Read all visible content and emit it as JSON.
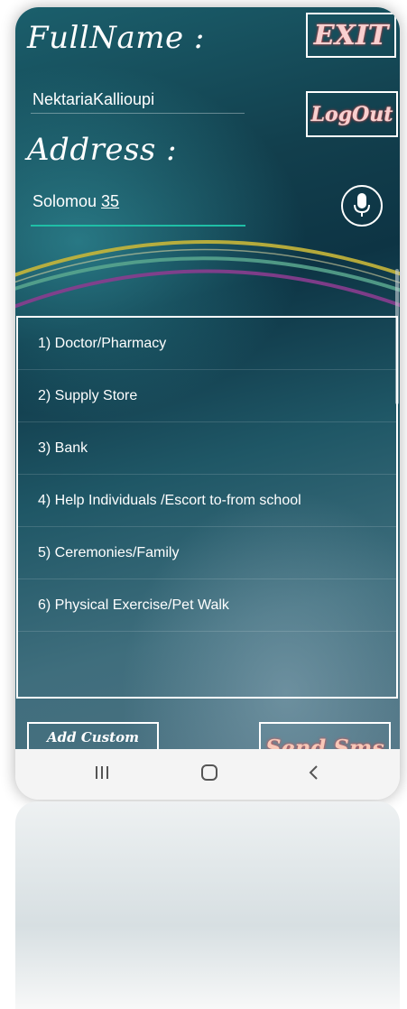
{
  "header": {
    "fullname_label": "FullName :",
    "fullname_value": "NektariaKallioupi",
    "address_label": "Address :",
    "address_street": "Solomou ",
    "address_number": "35",
    "exit_label": "EXIT",
    "logout_label": "LogOut"
  },
  "categories": [
    "1)  Doctor/Pharmacy",
    "2)  Supply Store",
    "3)  Bank",
    "4)  Help Individuals /Escort to-from school",
    "5)  Ceremonies/Family",
    "6)  Physical Exercise/Pet Walk"
  ],
  "buttons": {
    "add_custom_label": "Add Custom",
    "send_label": "Send Sms"
  },
  "icons": {
    "mic": "microphone-icon",
    "recents": "recent-apps-icon",
    "home": "home-icon",
    "back": "back-icon"
  },
  "colors": {
    "accent_underline": "#1fbfa6",
    "button_text": "#f8d0d0",
    "background_dark": "#0d3444"
  }
}
